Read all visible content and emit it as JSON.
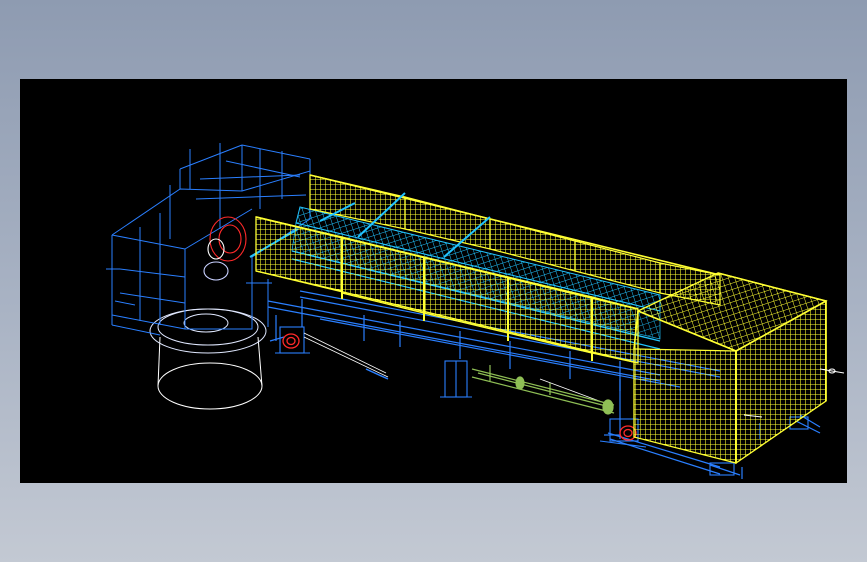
{
  "viewport": {
    "background": "#000000"
  },
  "colors": {
    "page_gradient_top": "#8e9bb1",
    "page_gradient_bottom": "#c3c9d3",
    "guard_yellow": "#ffff33",
    "frame_blue": "#2a7fff",
    "frame_blue_dark": "#1f5fd6",
    "conveyor_cyan": "#22c4ff",
    "motor_red": "#ff2a2a",
    "cylinder_green": "#8fbf55",
    "wire_white": "#ffffff"
  },
  "drawing": {
    "kind": "3D wireframe CAD model",
    "parts": [
      "blue-structural-frame",
      "yellow-mesh-guards",
      "cyan-conveyor-rollers",
      "red-drive-motors",
      "green-hydraulic-cylinder",
      "white-round-tank"
    ]
  }
}
